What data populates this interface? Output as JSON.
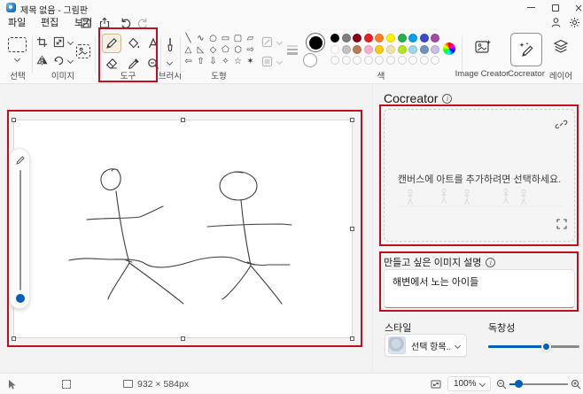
{
  "window": {
    "title": "제목 없음 - 그림판"
  },
  "menu": {
    "items": [
      {
        "label": "파일"
      },
      {
        "label": "편집"
      },
      {
        "label": "보기"
      }
    ]
  },
  "toolbar": {
    "groups": {
      "select": {
        "label": "선택"
      },
      "image": {
        "label": "이미지"
      },
      "tools": {
        "label": "도구"
      },
      "brushes": {
        "label": "브러시"
      },
      "shapes": {
        "label": "도형",
        "glyphs": [
          "╲",
          "∿",
          "○",
          "▭",
          "▢",
          "▱",
          "△",
          "◺",
          "◇",
          "⬠",
          "⬡",
          "⇨",
          "⇦",
          "⇧",
          "⇩",
          "✧",
          "☆",
          "✶"
        ]
      },
      "colors": {
        "label": "색",
        "color1": "#000000",
        "color2": "#ffffff",
        "palette_row1": [
          "#000000",
          "#7f7f7f",
          "#880015",
          "#ed1c24",
          "#ff7f27",
          "#fff200",
          "#22b14c",
          "#00a2e8",
          "#3f48cc",
          "#a349a4"
        ],
        "palette_row2": [
          "#ffffff",
          "#c3c3c3",
          "#b97a57",
          "#ffaec9",
          "#ffc90e",
          "#efe4b0",
          "#b5e61d",
          "#99d9ea",
          "#7092be",
          "#c8bfe7"
        ],
        "empty_slots": 10
      }
    },
    "right_buttons": [
      {
        "label": "Image Creator",
        "selected": false
      },
      {
        "label": "Cocreator",
        "selected": true
      },
      {
        "label": "레이어",
        "selected": false
      }
    ]
  },
  "cocreator": {
    "title": "Cocreator",
    "hint": "캔버스에 아트를 추가하려면 선택하세요.",
    "description_label": "만들고 싶은 이미지 설명",
    "description_value": "해변에서 노는 아이들",
    "style_label": "스타일",
    "style_value": "선택 항목...",
    "creativity_label": "독창성",
    "creativity_percent": 63
  },
  "status_bar": {
    "canvas_size": "932 × 584px",
    "zoom": "100%",
    "zoom_slider_percent": 15
  },
  "colors": {
    "accent": "#005fb8",
    "annotation": "#c01020"
  }
}
